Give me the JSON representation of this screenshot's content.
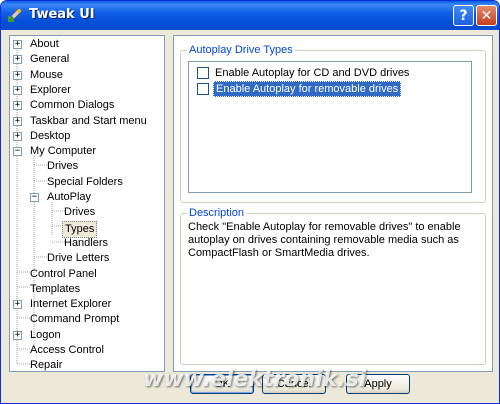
{
  "window": {
    "title": "Tweak UI",
    "help_glyph": "?",
    "close_glyph": "✕"
  },
  "tree": {
    "items": [
      {
        "label": "About",
        "expander": "+"
      },
      {
        "label": "General",
        "expander": "+"
      },
      {
        "label": "Mouse",
        "expander": "+"
      },
      {
        "label": "Explorer",
        "expander": "+"
      },
      {
        "label": "Common Dialogs",
        "expander": "+"
      },
      {
        "label": "Taskbar and Start menu",
        "expander": "+"
      },
      {
        "label": "Desktop",
        "expander": "+"
      },
      {
        "label": "My Computer",
        "expander": "−"
      },
      {
        "label": "Drives"
      },
      {
        "label": "Special Folders"
      },
      {
        "label": "AutoPlay",
        "expander": "−"
      },
      {
        "label": "Drives"
      },
      {
        "label": "Types",
        "selected": true
      },
      {
        "label": "Handlers"
      },
      {
        "label": "Drive Letters"
      },
      {
        "label": "Control Panel"
      },
      {
        "label": "Templates"
      },
      {
        "label": "Internet Explorer",
        "expander": "+"
      },
      {
        "label": "Command Prompt"
      },
      {
        "label": "Logon",
        "expander": "+"
      },
      {
        "label": "Access Control"
      },
      {
        "label": "Repair"
      }
    ]
  },
  "autoplay_types": {
    "group_title": "Autoplay Drive Types",
    "options": [
      {
        "label": "Enable Autoplay for CD and DVD drives",
        "checked": false,
        "selected": false
      },
      {
        "label": "Enable Autoplay for removable drives",
        "checked": false,
        "selected": true
      }
    ]
  },
  "description": {
    "group_title": "Description",
    "text": "Check \"Enable Autoplay for removable drives\" to enable autoplay on drives containing removable media such as CompactFlash or SmartMedia drives."
  },
  "buttons": {
    "ok": "OK",
    "cancel": "Cancel",
    "apply": "Apply"
  },
  "watermark": "www.elektronik.si",
  "colors": {
    "titlebar": "#0a5ae6",
    "selection": "#316ac5",
    "group_title": "#0046d5"
  }
}
